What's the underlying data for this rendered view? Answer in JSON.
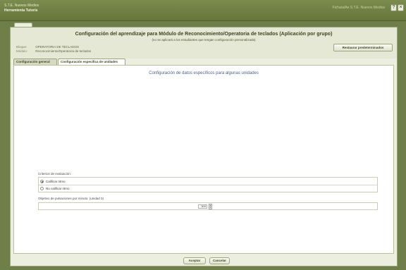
{
  "window": {
    "app_title": "S.T.E. Nuevos Medios",
    "app_subtitle": "Herramienta Tutor/a",
    "user_link": "Ficha/a/Ae S.T.E. Nuevos Medios",
    "help_label": "?",
    "close_label": "×"
  },
  "header": {
    "title": "Configuración del aprendizaje para Módulo de Reconocimiento/Operatoria de teclados (Aplicación por grupo)",
    "note": "(no se aplicará a los estudiantes que tengan configuración personalizada)",
    "meta": [
      {
        "key": "Bloque:",
        "value": "OPERATORIA DE TECLADOS"
      },
      {
        "key": "Módulo:",
        "value": "Reconocimiento/Operatoria de teclados"
      }
    ],
    "restore_label": "Restaurar predeterminados"
  },
  "tabs": [
    {
      "label": "Configuración general",
      "active": false
    },
    {
      "label": "Configuración específica de unidades",
      "active": true
    }
  ],
  "content": {
    "heading": "Configuración de datos específicos para algunas unidades",
    "criteria": {
      "label": "Criterios de evaluación:",
      "options": [
        {
          "label": "Calificar ritmo",
          "checked": true
        },
        {
          "label": "No calificar ritmo",
          "checked": false
        }
      ]
    },
    "goal": {
      "label": "Objetivo de pulsaciones por minuto: (unidad 3)",
      "value": "300",
      "stepper_icon": "spin-arrows-icon"
    }
  },
  "footer": {
    "accept_label": "Aceptar",
    "cancel_label": "Cancelar"
  }
}
